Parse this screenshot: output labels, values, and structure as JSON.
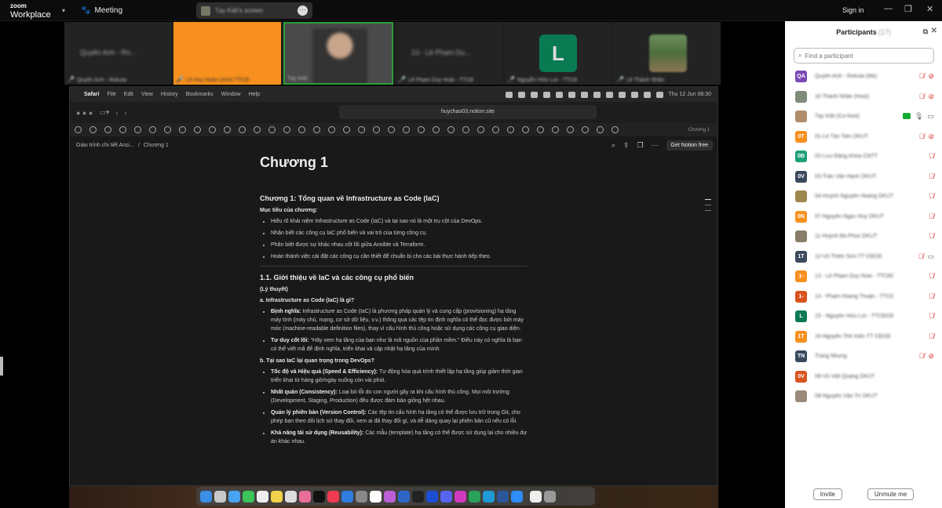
{
  "zoom": {
    "brand_top": "zoom",
    "brand_bottom": "Workplace",
    "meeting_label": "Meeting",
    "sign_in": "Sign in",
    "share_label": "Tạy Kiệt's screen"
  },
  "gallery": [
    {
      "name": "Quyên Anh - Rokuta",
      "bg": "#232323",
      "blurtext": "Quyên Anh - Ro..."
    },
    {
      "name": "Lê Huy Hoàn (Anh) TTCĐ",
      "bg": "#f7901e",
      "blurtext": ""
    },
    {
      "name": "Tạy Kiệt",
      "bg": "#4a4a4a",
      "blurtext": ""
    },
    {
      "name": "Lê Phạm Duy Hoài - TTCĐ",
      "bg": "#232323",
      "blurtext": "13 - Lê Phạm Du..."
    },
    {
      "name": "Nguyễn Hữu Lợi - TTCĐ",
      "bg": "#232323",
      "blurtext": "",
      "letter": "L"
    },
    {
      "name": "Lê Thành Nhân",
      "bg": "#232323",
      "blurtext": ""
    }
  ],
  "mac": {
    "menu": [
      "Safari",
      "File",
      "Edit",
      "View",
      "History",
      "Bookmarks",
      "Window",
      "Help"
    ],
    "clock": "Thu 12 Jun  08:30",
    "url": "huychao03.notion.site",
    "tab": "Chương 1"
  },
  "notion": {
    "breadcrumb1": "Giáo trình chi tiết Ansi...",
    "breadcrumb2": "Chương 1",
    "get_free": "Get Notion free",
    "title": "Chương 1",
    "h2": "Chương 1: Tổng quan về Infrastructure as Code (IaC)",
    "goals_label": "Mục tiêu của chương:",
    "goals": [
      "Hiểu rõ khái niệm Infrastructure as Code (IaC) và tại sao nó là một trụ cột của DevOps.",
      "Nhận biết các công cụ IaC phổ biến và vai trò của từng công cụ.",
      "Phân biệt được sự khác nhau cốt lõi giữa Ansible và Terraform.",
      "Hoàn thành việc cài đặt các công cụ cần thiết để chuẩn bị cho các bài thực hành tiếp theo."
    ],
    "h3": "1.1. Giới thiệu về IaC và các công cụ phổ biến",
    "theory": "(Lý thuyết)",
    "qa": "a. Infrastructure as Code (IaC) là gì?",
    "a_items": [
      {
        "b": "Định nghĩa:",
        "t": " Infrastructure as Code (IaC) là phương pháp quản lý và cung cấp (provisioning) hạ tầng máy tính (máy chủ, mạng, cơ sở dữ liệu, v.v.) thông qua các tệp tin định nghĩa có thể đọc được bởi máy móc (machine-readable definition files), thay vì cấu hình thủ công hoặc sử dụng các công cụ giao diện."
      },
      {
        "b": "Tư duy cốt lõi:",
        "t": " \"Hãy xem hạ tầng của bạn như là mã nguồn của phần mềm.\" Điều này có nghĩa là bạn có thể viết mã để định nghĩa, triển khai và cập nhật hạ tầng của mình."
      }
    ],
    "qb": "b. Tại sao IaC lại quan trọng trong DevOps?",
    "b_items": [
      {
        "b": "Tốc độ và Hiệu quả (Speed & Efficiency):",
        "t": " Tự động hóa quá trình thiết lập hạ tầng giúp giảm thời gian triển khai từ hàng giờ/ngày xuống còn vài phút."
      },
      {
        "b": "Nhất quán (Consistency):",
        "t": " Loại bỏ lỗi do con người gây ra khi cấu hình thủ công. Mọi môi trường (Development, Staging, Production) đều được đảm bảo giống hệt nhau."
      },
      {
        "b": "Quản lý phiên bản (Version Control):",
        "t": " Các tệp tin cấu hình hạ tầng có thể được lưu trữ trong Git, cho phép bạn theo dõi lịch sử thay đổi, xem ai đã thay đổi gì, và dễ dàng quay lại phiên bản cũ nếu có lỗi."
      },
      {
        "b": "Khả năng tái sử dụng (Reusability):",
        "t": " Các mẫu (template) hạ tầng có thể được sử dụng lại cho nhiều dự án khác nhau."
      }
    ]
  },
  "participants": {
    "title": "Participants",
    "count": "(17)",
    "search_placeholder": "Find a participant",
    "invite": "Invite",
    "unmute": "Unmute me",
    "list": [
      {
        "init": "QA",
        "color": "#7b4bb5",
        "name": "Quyên Anh - Rokuta (Me)"
      },
      {
        "init": "",
        "color": "#7f8c7a",
        "name": "10 Thành Nhân (Host)"
      },
      {
        "init": "",
        "color": "#b08d6a",
        "name": "Tạy Kiệt (Co-host)"
      },
      {
        "init": "0T",
        "color": "#f7901e",
        "name": "01-Lê Tấn Tiến DKUT"
      },
      {
        "init": "0Đ",
        "color": "#1ea07a",
        "name": "02-Lưu Đặng Khoa CNTT"
      },
      {
        "init": "0V",
        "color": "#3a4a5e",
        "name": "03-Trần Văn Hạnh DKUT"
      },
      {
        "init": "",
        "color": "#a0874e",
        "name": "04-Huỳnh Nguyễn Hoàng DKUT"
      },
      {
        "init": "0N",
        "color": "#f7901e",
        "name": "07-Nguyễn Ngọc Huy DKUT"
      },
      {
        "init": "",
        "color": "#8a7d6a",
        "name": "11-Huỳnh Bá Phúc DKUT"
      },
      {
        "init": "1T",
        "color": "#3a4a5e",
        "name": "12-Võ Thiên Sơn TT CĐCĐ"
      },
      {
        "init": "1-",
        "color": "#f7901e",
        "name": "13 - Lê Phạm Duy Hoài - TTCĐCĐ"
      },
      {
        "init": "1-",
        "color": "#d9531e",
        "name": "14 - Phạm Hoàng Thuận - TTCĐCĐ"
      },
      {
        "init": "L",
        "color": "#0a7a52",
        "name": "15 - Nguyễn Hữu Lợi - TTCĐCĐ"
      },
      {
        "init": "1T",
        "color": "#f7901e",
        "name": "16-Nguyễn Thế Kiên TT CĐCĐ"
      },
      {
        "init": "TN",
        "color": "#3a4a5e",
        "name": "Trang Nhung"
      },
      {
        "init": "0V",
        "color": "#d9531e",
        "name": "08-Võ Việt Quang DKUT"
      },
      {
        "init": "",
        "color": "#9a8a7a",
        "name": "09-Nguyễn Văn Trí DKUT"
      }
    ]
  }
}
